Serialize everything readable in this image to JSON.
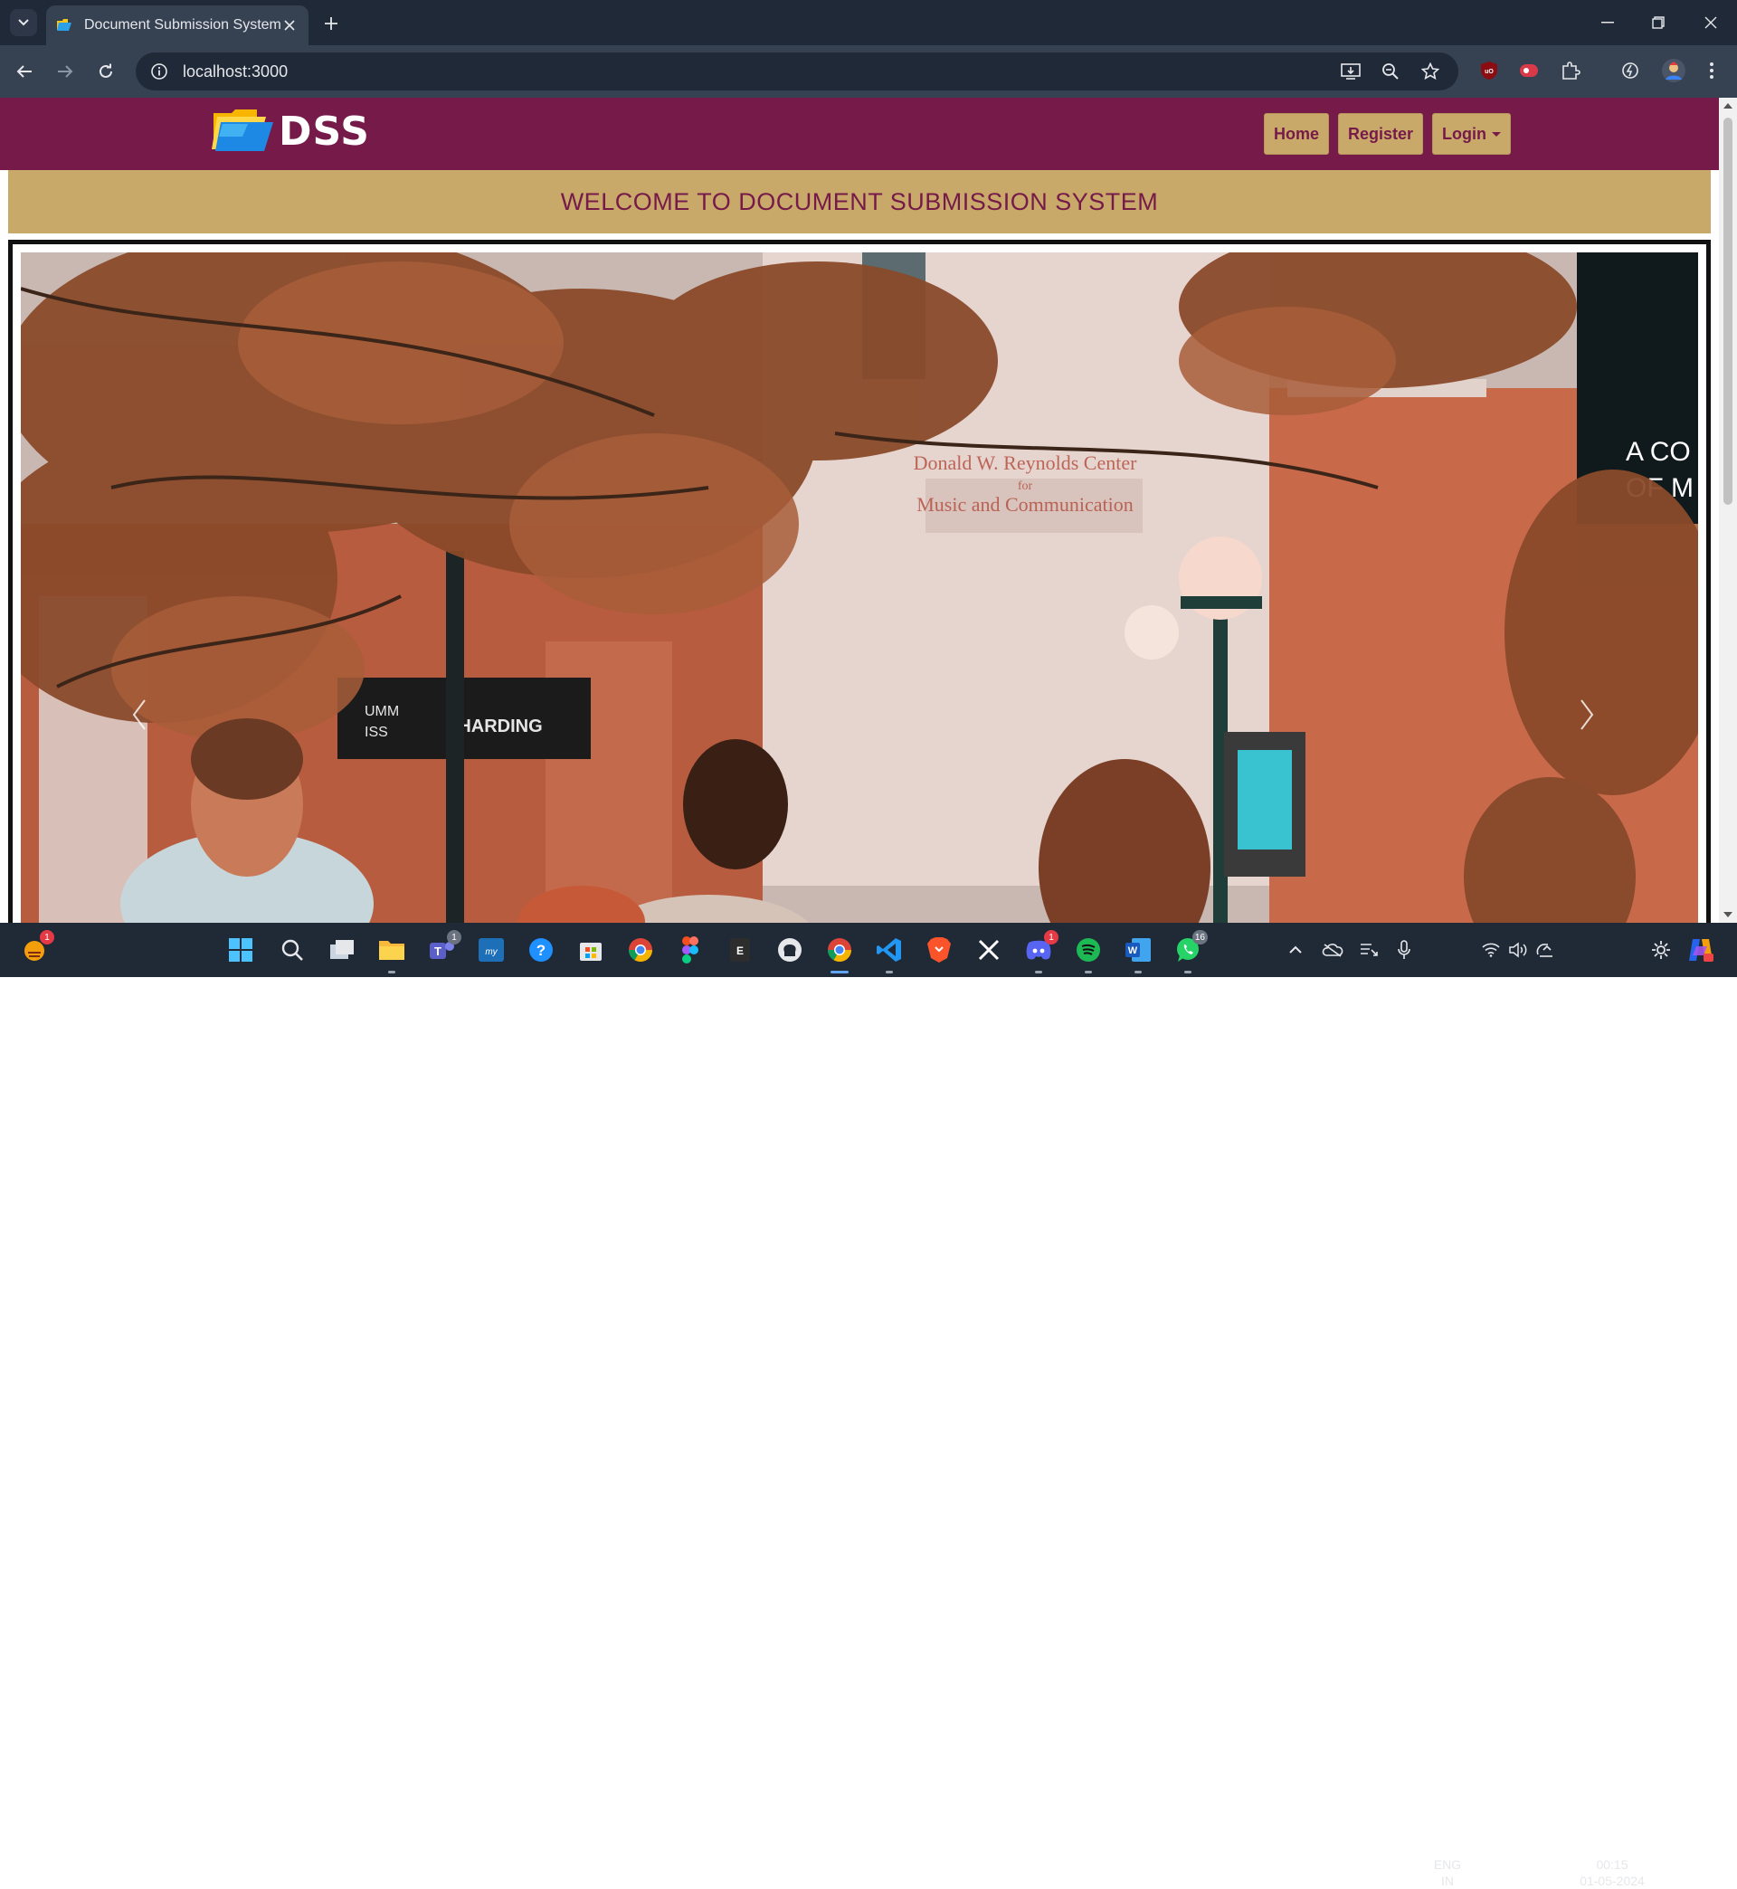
{
  "browser": {
    "tab_title": "Document Submission System",
    "url": "localhost:3000"
  },
  "site": {
    "logo_text": "DSS",
    "nav": {
      "home": "Home",
      "register": "Register",
      "login": "Login"
    },
    "welcome": "WELCOME TO DOCUMENT SUBMISSION SYSTEM",
    "carousel": {
      "banner_text_1": "A CO",
      "banner_text_2": "OF M",
      "building_sign_1": "Donald W. Reynolds Center",
      "building_sign_2": "for",
      "building_sign_3": "Music and Communication",
      "side_sign_1": "HARDING",
      "side_sign_2": "UMM",
      "side_sign_3": "ISS"
    }
  },
  "taskbar": {
    "badges": {
      "widget": "1",
      "teams": "1",
      "discord": "1",
      "whatsapp": "16"
    },
    "language_1": "ENG",
    "language_2": "IN",
    "time": "00:15",
    "date": "01-05-2024"
  },
  "colors": {
    "brand_maroon": "#761a49",
    "brand_gold": "#c9a96a"
  }
}
